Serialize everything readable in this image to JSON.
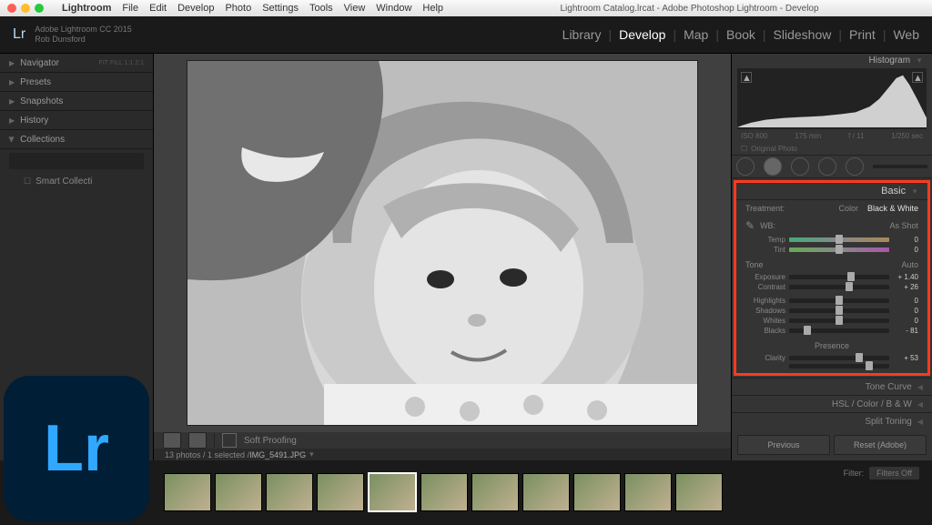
{
  "mac": {
    "app": "Lightroom",
    "menus": [
      "File",
      "Edit",
      "Develop",
      "Photo",
      "Settings",
      "Tools",
      "View",
      "Window",
      "Help"
    ],
    "title": "Lightroom Catalog.lrcat - Adobe Photoshop Lightroom - Develop"
  },
  "brand": {
    "line1": "Adobe Lightroom CC 2015",
    "line2": "Rob Dunsford"
  },
  "modules": [
    "Library",
    "Develop",
    "Map",
    "Book",
    "Slideshow",
    "Print",
    "Web"
  ],
  "active_module": "Develop",
  "left_panels": {
    "navigator": "Navigator",
    "presets": "Presets",
    "snapshots": "Snapshots",
    "history": "History",
    "collections": "Collections"
  },
  "nav_badges": "FIT  FILL  1:1  2:1",
  "collection_item": "Smart Collecti",
  "toolbar": {
    "soft": "Soft Proofing"
  },
  "status": {
    "count": "13 photos / 1 selected / ",
    "file": "IMG_5491.JPG"
  },
  "right": {
    "histogram": "Histogram",
    "histo_meta": [
      "ISO 800",
      "175 mm",
      "f / 11",
      "1/250 sec"
    ],
    "orig": "Original Photo",
    "basic": "Basic",
    "treatment_lbl": "Treatment:",
    "color_lbl": "Color",
    "bw_lbl": "Black & White",
    "wb_lbl": "WB:",
    "wb_val": "As Shot",
    "sliders": {
      "temp": {
        "label": "Temp",
        "value": "0",
        "pos": 50
      },
      "tint": {
        "label": "Tint",
        "value": "0",
        "pos": 50
      },
      "tone_label": "Tone",
      "auto": "Auto",
      "exposure": {
        "label": "Exposure",
        "value": "+ 1.40",
        "pos": 62
      },
      "contrast": {
        "label": "Contrast",
        "value": "+ 26",
        "pos": 60
      },
      "highlights": {
        "label": "Highlights",
        "value": "0",
        "pos": 50
      },
      "shadows": {
        "label": "Shadows",
        "value": "0",
        "pos": 50
      },
      "whites": {
        "label": "Whites",
        "value": "0",
        "pos": 50
      },
      "blacks": {
        "label": "Blacks",
        "value": "- 81",
        "pos": 18
      },
      "presence": "Presence",
      "clarity": {
        "label": "Clarity",
        "value": "+ 53",
        "pos": 70
      },
      "vibrance": {
        "label": "",
        "value": "",
        "pos": 80
      }
    },
    "panels": {
      "tonecurve": "Tone Curve",
      "hsl": "HSL / Color / B & W",
      "split": "Split Toning"
    },
    "buttons": {
      "prev": "Previous",
      "reset": "Reset (Adobe)"
    }
  },
  "filter": {
    "label": "Filter:",
    "value": "Filters Off"
  },
  "badge": "Lr"
}
